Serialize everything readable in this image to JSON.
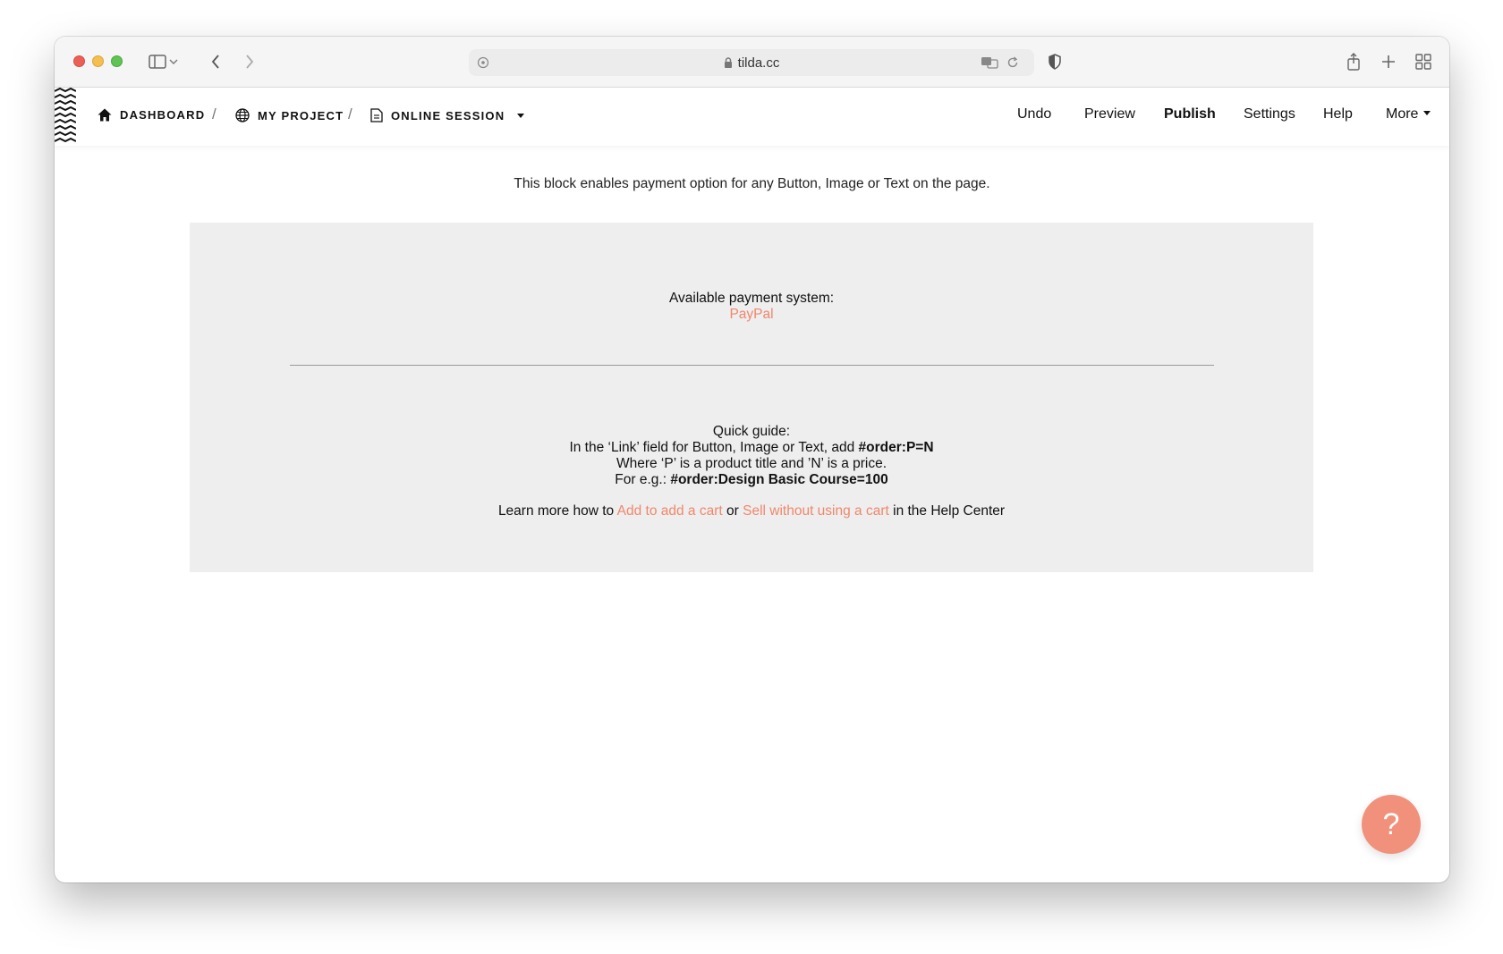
{
  "browser": {
    "url": "tilda.cc"
  },
  "topbar": {
    "breadcrumbs": [
      {
        "label": "DASHBOARD",
        "icon": "home-icon"
      },
      {
        "label": "MY PROJECT",
        "icon": "globe-icon"
      },
      {
        "label": "ONLINE SESSION",
        "icon": "page-icon"
      }
    ],
    "separator": "/",
    "menu": {
      "undo": "Undo",
      "preview": "Preview",
      "publish": "Publish",
      "settings": "Settings",
      "help": "Help",
      "more": "More"
    }
  },
  "content": {
    "intro": "This block enables payment option for any Button, Image or Text on the page.",
    "payment_label": "Available payment system:",
    "payment_system": "PayPal",
    "guide_title": "Quick guide:",
    "guide_line1_prefix": "In the ‘Link’ field for Button, Image or Text, add ",
    "guide_line1_code": "#order:P=N",
    "guide_line2": "Where ‘P’ is a product title and ’N’ is a price.",
    "guide_line3_prefix": "For e.g.: ",
    "guide_line3_code": "#order:Design Basic Course=100",
    "learn_prefix": "Learn more how to ",
    "learn_link1": "Add to add a cart",
    "learn_mid": " or ",
    "learn_link2": "Sell without using a cart",
    "learn_suffix": " in the Help Center"
  },
  "help_button": "?",
  "colors": {
    "accent": "#f0876c",
    "panel_bg": "#eeeeee",
    "fab": "#f2917b"
  }
}
